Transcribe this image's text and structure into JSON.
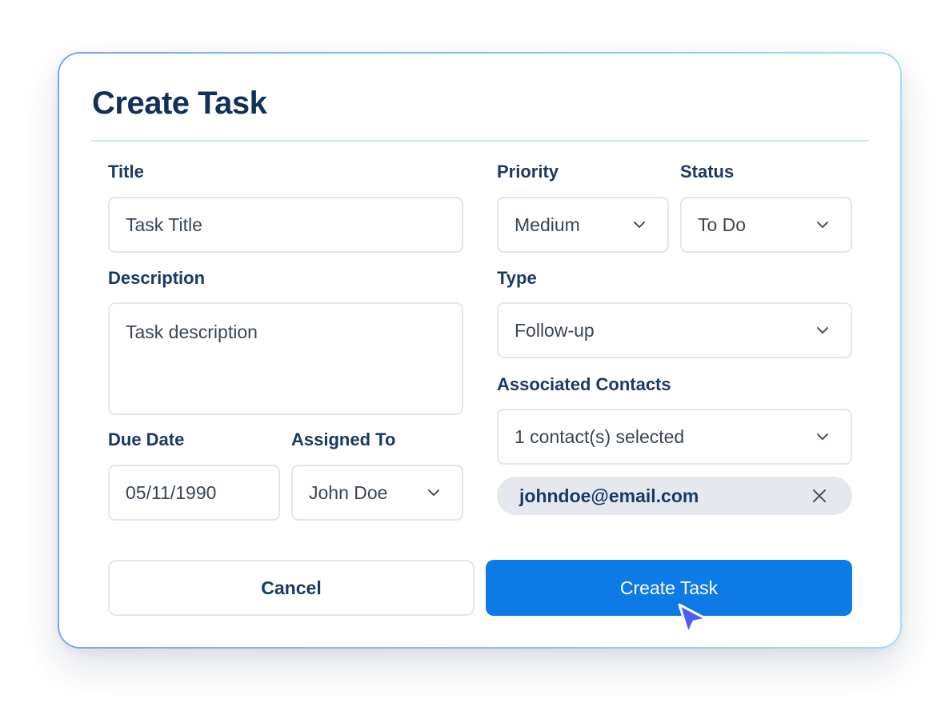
{
  "dialog": {
    "title": "Create Task"
  },
  "form": {
    "title": {
      "label": "Title",
      "value": "Task Title"
    },
    "description": {
      "label": "Description",
      "value": "Task description"
    },
    "due_date": {
      "label": "Due Date",
      "value": "05/11/1990"
    },
    "assigned_to": {
      "label": "Assigned To",
      "value": "John Doe"
    },
    "priority": {
      "label": "Priority",
      "value": "Medium"
    },
    "status": {
      "label": "Status",
      "value": "To Do"
    },
    "type": {
      "label": "Type",
      "value": "Follow-up"
    },
    "contacts": {
      "label": "Associated Contacts",
      "value": "1 contact(s) selected",
      "chips": [
        "johndoe@email.com"
      ]
    }
  },
  "actions": {
    "cancel_label": "Cancel",
    "create_label": "Create Task"
  },
  "icons": {
    "dropdown": "chevron-down-icon",
    "remove": "close-icon",
    "pointer": "mouse-cursor-icon"
  },
  "colors": {
    "primary": "#0e7ae6",
    "title": "#12305a",
    "label": "#1a3a63",
    "field_border": "#e2e7ed",
    "chip_bg": "#e4e9f0",
    "cursor": "#4d5ff2"
  }
}
